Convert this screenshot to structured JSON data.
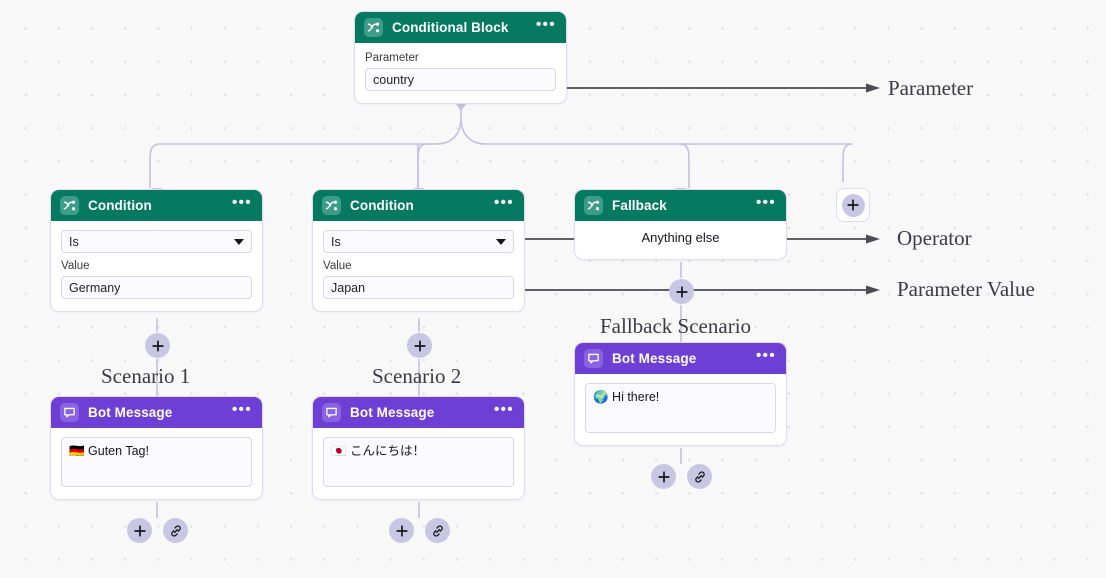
{
  "canvas": {
    "background": "#f8f8f9",
    "dot_color": "#e0e0e2"
  },
  "theme": {
    "condition_header": "#067a61",
    "message_header": "#6d3fd4",
    "connector": "#c4c1dd",
    "annotation_arrow": "#4a4a52"
  },
  "nodes": {
    "conditional_block": {
      "title": "Conditional Block",
      "icon": "branch-icon",
      "menu": "•••",
      "parameter_label": "Parameter",
      "parameter_value": "country"
    },
    "condition_1": {
      "title": "Condition",
      "icon": "branch-icon",
      "menu": "•••",
      "operator": "Is",
      "value_label": "Value",
      "value": "Germany"
    },
    "condition_2": {
      "title": "Condition",
      "icon": "branch-icon",
      "menu": "•••",
      "operator": "Is",
      "value_label": "Value",
      "value": "Japan"
    },
    "fallback": {
      "title": "Fallback",
      "icon": "branch-icon",
      "menu": "•••",
      "text": "Anything else"
    },
    "bot_message_1": {
      "title": "Bot Message",
      "icon": "speech-bubble-icon",
      "menu": "•••",
      "text": "🇩🇪 Guten Tag!"
    },
    "bot_message_2": {
      "title": "Bot Message",
      "icon": "speech-bubble-icon",
      "menu": "•••",
      "text": "🇯🇵 こんにちは！"
    },
    "bot_message_3": {
      "title": "Bot Message",
      "icon": "speech-bubble-icon",
      "menu": "•••",
      "text": "🌍 Hi there!"
    }
  },
  "annotations": {
    "parameter": "Parameter",
    "operator": "Operator",
    "parameter_value": "Parameter Value",
    "scenario_1": "Scenario 1",
    "scenario_2": "Scenario 2",
    "fallback_scenario": "Fallback Scenario"
  },
  "buttons": {
    "add": "add-step-button",
    "link": "link-step-button"
  }
}
